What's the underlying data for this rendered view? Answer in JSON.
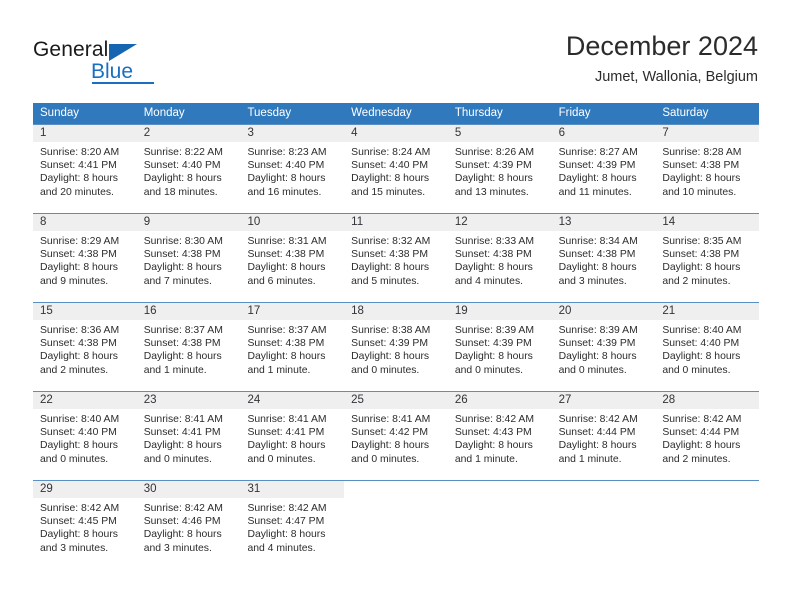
{
  "brand": {
    "name_part1": "General",
    "name_part2": "Blue",
    "triangle_icon": "blue-triangle-icon"
  },
  "header": {
    "title": "December 2024",
    "subtitle": "Jumet, Wallonia, Belgium"
  },
  "colors": {
    "header_blue": "#3079bd",
    "row_divider_blue": "#5a8fc4",
    "day_band_gray": "#efefef",
    "brand_blue": "#1a6fc0"
  },
  "weekdays": [
    "Sunday",
    "Monday",
    "Tuesday",
    "Wednesday",
    "Thursday",
    "Friday",
    "Saturday"
  ],
  "weeks": [
    [
      {
        "day": "1",
        "sunrise": "Sunrise: 8:20 AM",
        "sunset": "Sunset: 4:41 PM",
        "daylight1": "Daylight: 8 hours",
        "daylight2": "and 20 minutes."
      },
      {
        "day": "2",
        "sunrise": "Sunrise: 8:22 AM",
        "sunset": "Sunset: 4:40 PM",
        "daylight1": "Daylight: 8 hours",
        "daylight2": "and 18 minutes."
      },
      {
        "day": "3",
        "sunrise": "Sunrise: 8:23 AM",
        "sunset": "Sunset: 4:40 PM",
        "daylight1": "Daylight: 8 hours",
        "daylight2": "and 16 minutes."
      },
      {
        "day": "4",
        "sunrise": "Sunrise: 8:24 AM",
        "sunset": "Sunset: 4:40 PM",
        "daylight1": "Daylight: 8 hours",
        "daylight2": "and 15 minutes."
      },
      {
        "day": "5",
        "sunrise": "Sunrise: 8:26 AM",
        "sunset": "Sunset: 4:39 PM",
        "daylight1": "Daylight: 8 hours",
        "daylight2": "and 13 minutes."
      },
      {
        "day": "6",
        "sunrise": "Sunrise: 8:27 AM",
        "sunset": "Sunset: 4:39 PM",
        "daylight1": "Daylight: 8 hours",
        "daylight2": "and 11 minutes."
      },
      {
        "day": "7",
        "sunrise": "Sunrise: 8:28 AM",
        "sunset": "Sunset: 4:38 PM",
        "daylight1": "Daylight: 8 hours",
        "daylight2": "and 10 minutes."
      }
    ],
    [
      {
        "day": "8",
        "sunrise": "Sunrise: 8:29 AM",
        "sunset": "Sunset: 4:38 PM",
        "daylight1": "Daylight: 8 hours",
        "daylight2": "and 9 minutes."
      },
      {
        "day": "9",
        "sunrise": "Sunrise: 8:30 AM",
        "sunset": "Sunset: 4:38 PM",
        "daylight1": "Daylight: 8 hours",
        "daylight2": "and 7 minutes."
      },
      {
        "day": "10",
        "sunrise": "Sunrise: 8:31 AM",
        "sunset": "Sunset: 4:38 PM",
        "daylight1": "Daylight: 8 hours",
        "daylight2": "and 6 minutes."
      },
      {
        "day": "11",
        "sunrise": "Sunrise: 8:32 AM",
        "sunset": "Sunset: 4:38 PM",
        "daylight1": "Daylight: 8 hours",
        "daylight2": "and 5 minutes."
      },
      {
        "day": "12",
        "sunrise": "Sunrise: 8:33 AM",
        "sunset": "Sunset: 4:38 PM",
        "daylight1": "Daylight: 8 hours",
        "daylight2": "and 4 minutes."
      },
      {
        "day": "13",
        "sunrise": "Sunrise: 8:34 AM",
        "sunset": "Sunset: 4:38 PM",
        "daylight1": "Daylight: 8 hours",
        "daylight2": "and 3 minutes."
      },
      {
        "day": "14",
        "sunrise": "Sunrise: 8:35 AM",
        "sunset": "Sunset: 4:38 PM",
        "daylight1": "Daylight: 8 hours",
        "daylight2": "and 2 minutes."
      }
    ],
    [
      {
        "day": "15",
        "sunrise": "Sunrise: 8:36 AM",
        "sunset": "Sunset: 4:38 PM",
        "daylight1": "Daylight: 8 hours",
        "daylight2": "and 2 minutes."
      },
      {
        "day": "16",
        "sunrise": "Sunrise: 8:37 AM",
        "sunset": "Sunset: 4:38 PM",
        "daylight1": "Daylight: 8 hours",
        "daylight2": "and 1 minute."
      },
      {
        "day": "17",
        "sunrise": "Sunrise: 8:37 AM",
        "sunset": "Sunset: 4:38 PM",
        "daylight1": "Daylight: 8 hours",
        "daylight2": "and 1 minute."
      },
      {
        "day": "18",
        "sunrise": "Sunrise: 8:38 AM",
        "sunset": "Sunset: 4:39 PM",
        "daylight1": "Daylight: 8 hours",
        "daylight2": "and 0 minutes."
      },
      {
        "day": "19",
        "sunrise": "Sunrise: 8:39 AM",
        "sunset": "Sunset: 4:39 PM",
        "daylight1": "Daylight: 8 hours",
        "daylight2": "and 0 minutes."
      },
      {
        "day": "20",
        "sunrise": "Sunrise: 8:39 AM",
        "sunset": "Sunset: 4:39 PM",
        "daylight1": "Daylight: 8 hours",
        "daylight2": "and 0 minutes."
      },
      {
        "day": "21",
        "sunrise": "Sunrise: 8:40 AM",
        "sunset": "Sunset: 4:40 PM",
        "daylight1": "Daylight: 8 hours",
        "daylight2": "and 0 minutes."
      }
    ],
    [
      {
        "day": "22",
        "sunrise": "Sunrise: 8:40 AM",
        "sunset": "Sunset: 4:40 PM",
        "daylight1": "Daylight: 8 hours",
        "daylight2": "and 0 minutes."
      },
      {
        "day": "23",
        "sunrise": "Sunrise: 8:41 AM",
        "sunset": "Sunset: 4:41 PM",
        "daylight1": "Daylight: 8 hours",
        "daylight2": "and 0 minutes."
      },
      {
        "day": "24",
        "sunrise": "Sunrise: 8:41 AM",
        "sunset": "Sunset: 4:41 PM",
        "daylight1": "Daylight: 8 hours",
        "daylight2": "and 0 minutes."
      },
      {
        "day": "25",
        "sunrise": "Sunrise: 8:41 AM",
        "sunset": "Sunset: 4:42 PM",
        "daylight1": "Daylight: 8 hours",
        "daylight2": "and 0 minutes."
      },
      {
        "day": "26",
        "sunrise": "Sunrise: 8:42 AM",
        "sunset": "Sunset: 4:43 PM",
        "daylight1": "Daylight: 8 hours",
        "daylight2": "and 1 minute."
      },
      {
        "day": "27",
        "sunrise": "Sunrise: 8:42 AM",
        "sunset": "Sunset: 4:44 PM",
        "daylight1": "Daylight: 8 hours",
        "daylight2": "and 1 minute."
      },
      {
        "day": "28",
        "sunrise": "Sunrise: 8:42 AM",
        "sunset": "Sunset: 4:44 PM",
        "daylight1": "Daylight: 8 hours",
        "daylight2": "and 2 minutes."
      }
    ],
    [
      {
        "day": "29",
        "sunrise": "Sunrise: 8:42 AM",
        "sunset": "Sunset: 4:45 PM",
        "daylight1": "Daylight: 8 hours",
        "daylight2": "and 3 minutes."
      },
      {
        "day": "30",
        "sunrise": "Sunrise: 8:42 AM",
        "sunset": "Sunset: 4:46 PM",
        "daylight1": "Daylight: 8 hours",
        "daylight2": "and 3 minutes."
      },
      {
        "day": "31",
        "sunrise": "Sunrise: 8:42 AM",
        "sunset": "Sunset: 4:47 PM",
        "daylight1": "Daylight: 8 hours",
        "daylight2": "and 4 minutes."
      },
      {
        "day": "",
        "sunrise": "",
        "sunset": "",
        "daylight1": "",
        "daylight2": ""
      },
      {
        "day": "",
        "sunrise": "",
        "sunset": "",
        "daylight1": "",
        "daylight2": ""
      },
      {
        "day": "",
        "sunrise": "",
        "sunset": "",
        "daylight1": "",
        "daylight2": ""
      },
      {
        "day": "",
        "sunrise": "",
        "sunset": "",
        "daylight1": "",
        "daylight2": ""
      }
    ]
  ]
}
